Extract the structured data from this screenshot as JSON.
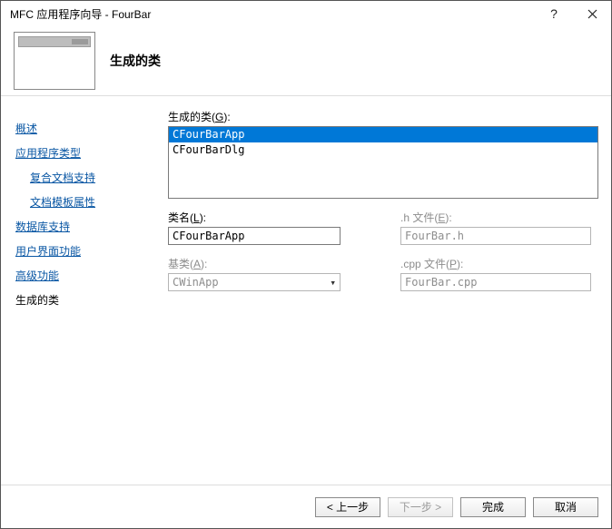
{
  "window": {
    "title": "MFC 应用程序向导 - FourBar"
  },
  "header": {
    "title": "生成的类"
  },
  "sidebar": {
    "items": [
      {
        "label": "概述",
        "indent": false,
        "current": false
      },
      {
        "label": "应用程序类型",
        "indent": false,
        "current": false
      },
      {
        "label": "复合文档支持",
        "indent": true,
        "current": false
      },
      {
        "label": "文档模板属性",
        "indent": true,
        "current": false
      },
      {
        "label": "数据库支持",
        "indent": false,
        "current": false
      },
      {
        "label": "用户界面功能",
        "indent": false,
        "current": false
      },
      {
        "label": "高级功能",
        "indent": false,
        "current": false
      },
      {
        "label": "生成的类",
        "indent": false,
        "current": true
      }
    ]
  },
  "main": {
    "generated_classes_label": "生成的类(G):",
    "generated_classes": [
      {
        "name": "CFourBarApp",
        "selected": true
      },
      {
        "name": "CFourBarDlg",
        "selected": false
      }
    ],
    "class_name_label": "类名(L):",
    "class_name_value": "CFourBarApp",
    "h_file_label": ".h 文件(E):",
    "h_file_value": "FourBar.h",
    "base_class_label": "基类(A):",
    "base_class_value": "CWinApp",
    "cpp_file_label": ".cpp 文件(P):",
    "cpp_file_value": "FourBar.cpp"
  },
  "footer": {
    "prev": "< 上一步",
    "next": "下一步 >",
    "finish": "完成",
    "cancel": "取消"
  }
}
